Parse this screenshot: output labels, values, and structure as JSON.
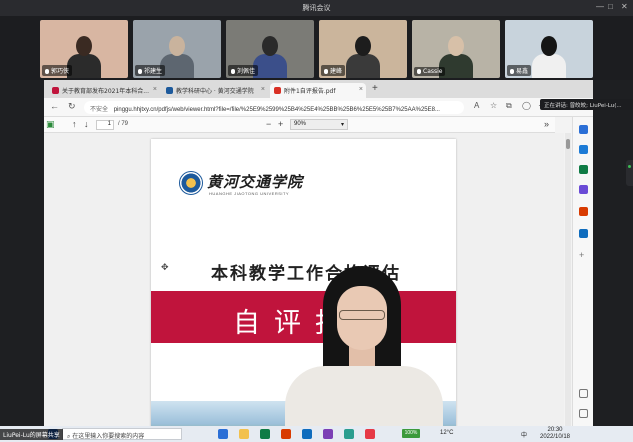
{
  "meeting": {
    "title": "腾讯会议",
    "window_controls": [
      "—",
      "□",
      "✕"
    ],
    "participants": [
      {
        "name": "郭巧侠",
        "bg": "#d8b6a2",
        "head": "#3a2a22",
        "body": "#2b2b2b"
      },
      {
        "name": "祁建生",
        "bg": "#9aa3ab",
        "head": "#c9b39d",
        "body": "#5d6670"
      },
      {
        "name": "刘佩佳",
        "bg": "#7b7b76",
        "head": "#2a2a2a",
        "body": "#3b4f8a"
      },
      {
        "name": "建峰",
        "bg": "#cbb59c",
        "head": "#1d1d1d",
        "body": "#3a3a3a"
      },
      {
        "name": "Cassie",
        "bg": "#b8b3a6",
        "head": "#d7c0a8",
        "body": "#2f3a2f"
      },
      {
        "name": "易鑫",
        "bg": "#c8d3dc",
        "head": "#151515",
        "body": "#f0f0f0"
      }
    ],
    "speaking_toast": "正在讲话: 曾皎皎; LiuPei-Lu(...",
    "presenter_label": "LiuPei-Lu的屏幕共享"
  },
  "browser": {
    "tabs": [
      {
        "label": "关于教育部发布2021年本科合...",
        "favicon": "#c0143c"
      },
      {
        "label": "教学科研中心 · 黄河交通学院",
        "favicon": "#1d5a9c"
      },
      {
        "label": "附件1自评报告.pdf",
        "favicon": "#d93025",
        "active": true
      }
    ],
    "new_tab": "+",
    "security": "不安全",
    "url": "pinggu.hhjtxy.cn/pdfjs/web/viewer.html?file=/file/%25E9%2599%25B4%25E4%25BB%25B6%25E5%25B7%25AA%25E8...",
    "nav": {
      "back": "←",
      "forward": "→",
      "refresh": "↻",
      "more": "···"
    }
  },
  "pdf_viewer": {
    "page_current": "1",
    "page_total": "/ 79",
    "zoom": "90%",
    "zoom_out": "−",
    "zoom_in": "+",
    "prev": "↑",
    "next": "↓",
    "expand": "»"
  },
  "document": {
    "logo_cn": "黄河交通学院",
    "logo_en": "HUANGHE JIAOTONG UNIVERSITY",
    "heading": "本科教学工作合格评估",
    "band_text": "自评报告",
    "colors": {
      "band": "#c0143c",
      "logo_blue": "#1d5a9c"
    }
  },
  "sidebar_icons": [
    {
      "name": "search-icon",
      "color": "#2b6fd6"
    },
    {
      "name": "bookmark-icon",
      "color": "#1d7bd6"
    },
    {
      "name": "shopping-icon",
      "color": "#0f7b45"
    },
    {
      "name": "people-icon",
      "color": "#6a4bd6"
    },
    {
      "name": "office-icon",
      "color": "#d83b01"
    },
    {
      "name": "outlook-icon",
      "color": "#0f6cbd"
    },
    {
      "name": "add-icon",
      "color": "#777777"
    }
  ],
  "taskbar": {
    "search_placeholder": "在这里输入你要搜索的内容",
    "battery": "100%",
    "weather": "12°C",
    "ime": "中",
    "time": "20:30",
    "date": "2022/10/18",
    "apps": [
      "#2b6fd6",
      "#f2c14e",
      "#0f7b45",
      "#d83b01",
      "#0f6cbd",
      "#7b3fb5",
      "#2a9d8f",
      "#e63946"
    ]
  }
}
